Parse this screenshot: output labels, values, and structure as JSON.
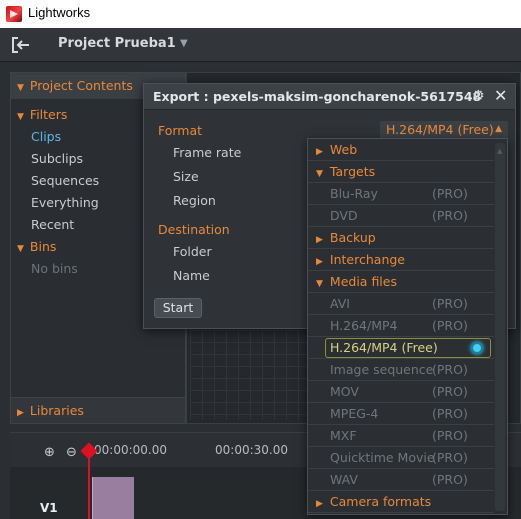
{
  "window": {
    "title": "Lightworks"
  },
  "app": {
    "project_name": "Project Prueba1"
  },
  "project_panel": {
    "header": "Project Contents",
    "filters_label": "Filters",
    "filters": [
      "Clips",
      "Subclips",
      "Sequences",
      "Everything",
      "Recent"
    ],
    "bins_label": "Bins",
    "no_bins": "No bins",
    "libraries_label": "Libraries"
  },
  "timeline": {
    "timecodes": [
      "00:00:00.00",
      "00:00:30.00"
    ],
    "track_label": "V1"
  },
  "export_dialog": {
    "title": "Export : pexels-maksim-goncharenok-5617548",
    "format_section": "Format",
    "format_value": "H.264/MP4 (Free)",
    "frame_rate_label": "Frame rate",
    "size_label": "Size",
    "region_label": "Region",
    "destination_section": "Destination",
    "folder_label": "Folder",
    "name_label": "Name",
    "start_label": "Start"
  },
  "format_menu": {
    "pro_tag": "(PRO)",
    "categories": {
      "web": "Web",
      "targets": "Targets",
      "backup": "Backup",
      "interchange": "Interchange",
      "media_files": "Media files",
      "camera_formats": "Camera formats"
    },
    "targets_items": [
      "Blu-Ray",
      "DVD"
    ],
    "media_items": [
      "AVI",
      "H.264/MP4",
      "H.264/MP4 (Free)",
      "Image sequence",
      "MOV",
      "MPEG-4",
      "MXF",
      "Quicktime Movie",
      "WAV"
    ],
    "selected_item": "H.264/MP4 (Free)"
  },
  "colors": {
    "accent_orange": "#e8883a",
    "selection_blue": "#5bb7e8",
    "radio_cyan": "#3fd0f2"
  }
}
